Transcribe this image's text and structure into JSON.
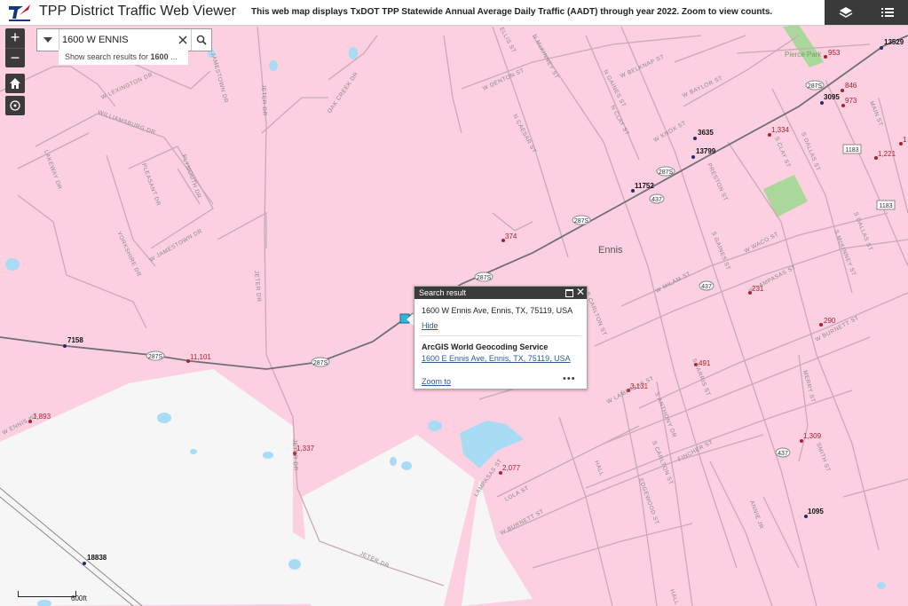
{
  "header": {
    "title": "TPP District Traffic Web Viewer",
    "description": "This web map displays TxDOT TPP Statewide Annual Average Daily Traffic (AADT) through year 2022.  Zoom to view counts.",
    "buttons": [
      {
        "icon": "layers-icon"
      },
      {
        "icon": "legend-list-icon"
      }
    ]
  },
  "controls": {
    "zoom_in": "+",
    "zoom_out": "−",
    "home_icon": "home-icon",
    "locate_icon": "locate-icon"
  },
  "search": {
    "value": "1600 W ENNIS",
    "suggestion_prefix": "Show search results for ",
    "suggestion_term": "1600",
    "suggestion_suffix": " ..."
  },
  "popup": {
    "title": "Search result",
    "address": "1600 W Ennis Ave, Ennis, TX, 75119, USA",
    "hide_label": "Hide",
    "source_title": "ArcGIS World Geocoding Service",
    "source_address": "1600 E Ennis Ave, Ennis, TX, 75119, USA",
    "zoom_to_label": "Zoom to",
    "more_label": "•••"
  },
  "scale": {
    "label": "600ft"
  },
  "map": {
    "colors": {
      "land": "#fcd0e0",
      "road": "#c8a8b6",
      "highway": "#7a7a80",
      "industrial": "#f6f6f6",
      "water": "#a8dcf4",
      "park": "#a9d89a",
      "count_blue": "#1e2e6e",
      "count_red": "#b21c28"
    },
    "place_labels": [
      "Ennis",
      "Pierce Park"
    ],
    "counts_blue": [
      "13529",
      "3095",
      "3635",
      "13799",
      "11752",
      "7158",
      "18838",
      "1095"
    ],
    "counts_red": [
      "953",
      "846",
      "973",
      "1,334",
      "1,221",
      "1",
      "374",
      "231",
      "290",
      "11,101",
      "1,893",
      "1,337",
      "491",
      "3,131",
      "2,077",
      "1,309"
    ],
    "shields": [
      "287S",
      "287S",
      "287S",
      "287S",
      "287S",
      "287S",
      "287S",
      "437",
      "437",
      "437",
      "1183",
      "1183"
    ],
    "streets": [
      "W DENTON ST",
      "W BELKNAP ST",
      "W BAYLOR ST",
      "W KNOX ST",
      "N GAINES ST",
      "N McKINNEY ST",
      "N CLAY ST",
      "ELLIS ST",
      "OAK CREEK DR",
      "N CAESAR ST",
      "W LEXINGTON DR",
      "WILLIAMSBURG DR",
      "JAMESTOWN DR",
      "LAKEWAY DR",
      "PLYMOUTH DR",
      "PLEASANT DR",
      "YORKSHIRE DR",
      "W JAMESTOWN DR",
      "JETER DR",
      "PRESTON ST",
      "S DALLAS ST",
      "MAIN ST",
      "S CLAY ST",
      "S DALLAS ST",
      "S McKINNEY ST",
      "W WACO ST",
      "W LAMPASAS ST",
      "W BURNETT ST",
      "W MILAM ST",
      "S GAINES ST",
      "S CARLTON ST",
      "W ENNIS WY",
      "W LAMPASAS ST",
      "S FARRIS ST",
      "S ANTHONY DR",
      "S CARLTON ST",
      "FINCHER ST",
      "MERRY ST",
      "SMITH ST",
      "HALL",
      "LAMPASAS ST",
      "W BURNETT ST",
      "EDGEWOOD ST",
      "LOLA ST",
      "ANNIE JR",
      "HALL"
    ]
  }
}
